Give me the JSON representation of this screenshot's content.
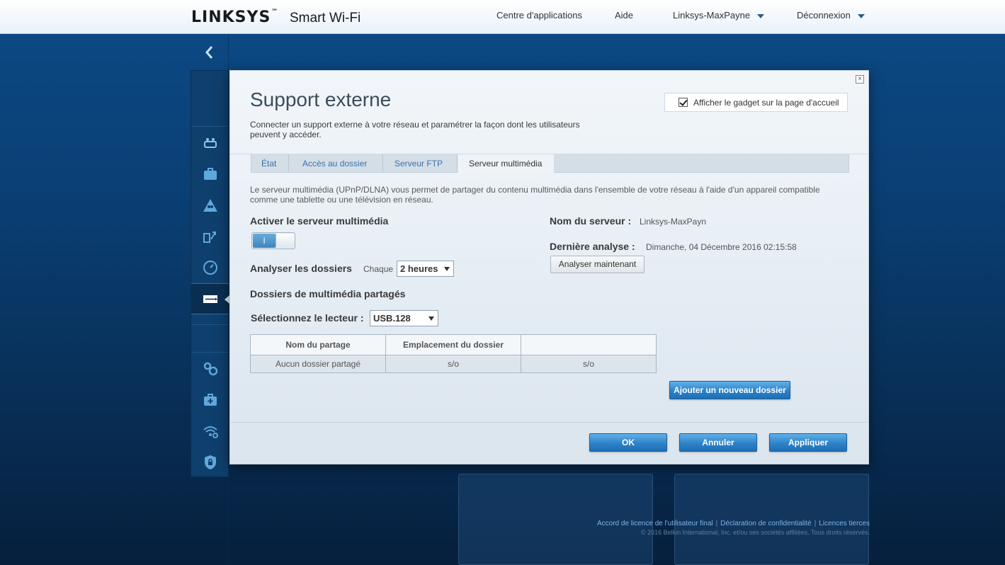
{
  "header": {
    "logo": "LINKSYS",
    "logo_tm": "™",
    "logo_sub": "Smart Wi-Fi",
    "nav": {
      "apps": "Centre d'applications",
      "help": "Aide",
      "router": "Linksys-MaxPayne",
      "logout": "Déconnexion"
    }
  },
  "modal": {
    "title": "Support externe",
    "subtitle": "Connecter un support externe à votre réseau et paramétrer la façon dont les utilisateurs peuvent y accéder.",
    "show_gadget": "Afficher le gadget sur la page d'accueil",
    "tabs": [
      "État",
      "Accès au dossier",
      "Serveur FTP",
      "Serveur multimédia"
    ],
    "description": "Le serveur multimédia (UPnP/DLNA) vous permet de partager du contenu multimédia dans l'ensemble de votre réseau à l'aide d'un appareil compatible comme une tablette ou une télévision en réseau.",
    "enable_label": "Activer le serveur multimédia",
    "toggle_on": "I",
    "scan_label": "Analyser les dossiers",
    "scan_every": "Chaque",
    "scan_interval": "2 heures",
    "shared_title": "Dossiers de multimédia partagés",
    "drive_label": "Sélectionnez le lecteur :",
    "drive_value": "USB.128",
    "server_name_label": "Nom du serveur :",
    "server_name_value": "Linksys-MaxPayn",
    "last_scan_label": "Dernière analyse :",
    "last_scan_value": "Dimanche, 04 Décembre 2016 02:15:58",
    "scan_now": "Analyser maintenant",
    "table": {
      "headers": [
        "Nom du partage",
        "Emplacement du dossier",
        ""
      ],
      "rows": [
        [
          "Aucun dossier partagé",
          "s/o",
          "s/o"
        ]
      ]
    },
    "add_folder": "Ajouter un nouveau dossier",
    "ok": "OK",
    "cancel": "Annuler",
    "apply": "Appliquer"
  },
  "footer": {
    "eula": "Accord de licence de l'utilisateur final",
    "privacy": "Déclaration de confidentialité",
    "third_party": "Licences tierces",
    "copyright": "© 2016 Belkin International, Inc. et/ou ses sociétés affiliées. Tous droits réservés."
  },
  "colors": {
    "accent": "#2d82c8",
    "background": "#0c4a86",
    "sidebar": "#0f3f6c"
  }
}
